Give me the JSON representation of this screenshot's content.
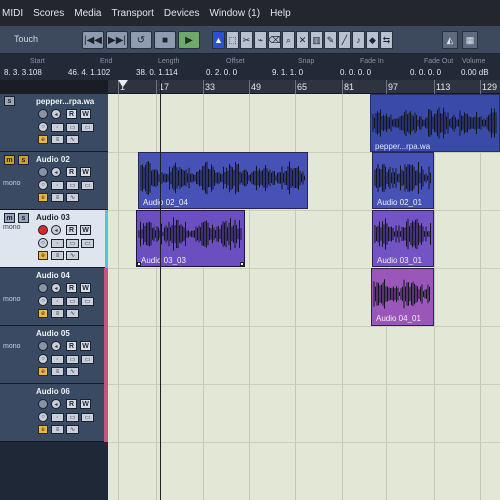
{
  "menu": [
    "MIDI",
    "Scores",
    "Media",
    "Transport",
    "Devices",
    "Window (1)",
    "Help"
  ],
  "toolbar": {
    "touch_label": "Touch",
    "transport": [
      "|◀◀",
      "▶▶|",
      "↺",
      "■",
      "▶",
      "●"
    ]
  },
  "info": {
    "headers": [
      "Start",
      "End",
      "Length",
      "Offset",
      "Snap",
      "Fade In",
      "Fade Out",
      "Volume"
    ],
    "values": [
      "8. 3. 3.108",
      "46. 4. 1.102",
      "38. 0. 1.114",
      "0. 2. 0. 0",
      "9. 1. 1. 0",
      "0. 0. 0. 0",
      "0. 0. 0. 0",
      "0.00 dB"
    ]
  },
  "ruler": [
    "1",
    "17",
    "33",
    "49",
    "65",
    "81",
    "97",
    "113",
    "129"
  ],
  "tracks": [
    {
      "name": "pepper...rpa.wa",
      "mono": ""
    },
    {
      "name": "Audio 02",
      "mono": "mono"
    },
    {
      "name": "Audio 03",
      "mono": "mono"
    },
    {
      "name": "Audio 04",
      "mono": "mono"
    },
    {
      "name": "Audio 05",
      "mono": "mono"
    },
    {
      "name": "Audio 06",
      "mono": ""
    }
  ],
  "track_buttons": {
    "mute": "m",
    "solo": "s",
    "read": "R",
    "write": "W"
  },
  "clips": [
    {
      "name": "pepper...rpa.wa",
      "track": 0
    },
    {
      "name": "Audio 02_04",
      "track": 1
    },
    {
      "name": "Audio 02_01",
      "track": 1
    },
    {
      "name": "Audio 03_03",
      "track": 2
    },
    {
      "name": "Audio 03_01",
      "track": 2
    },
    {
      "name": "Audio 04_01",
      "track": 3
    }
  ],
  "colors": {
    "clip_blue": "#4652b6",
    "clip_violet": "#6b4fc0",
    "clip_pink": "#9a56b8",
    "selected_tool": "#2e4fd0",
    "rec_armed": "#d42a2a"
  }
}
